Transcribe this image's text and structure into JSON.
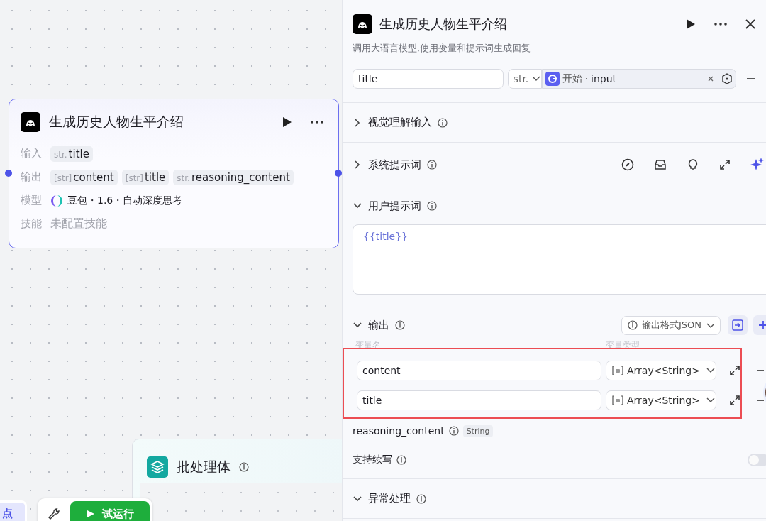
{
  "canvas": {
    "llm_node": {
      "title": "生成历史人物生平介绍",
      "selected": true,
      "rows": [
        {
          "kind": "tags",
          "label": "输入",
          "tags": [
            {
              "type": "str.",
              "name": "title"
            }
          ]
        },
        {
          "kind": "tags",
          "label": "输出",
          "tags": [
            {
              "type": "[str]",
              "name": "content"
            },
            {
              "type": "[str]",
              "name": "title"
            },
            {
              "type": "str.",
              "name": "reasoning_content"
            }
          ]
        },
        {
          "kind": "model",
          "label": "模型",
          "value": "豆包・1.6・自动深度思考"
        },
        {
          "kind": "empty",
          "label": "技能",
          "value": "未配置技能"
        }
      ]
    },
    "batch_node": {
      "title": "批处理体"
    },
    "toolbar": {
      "partial_button": "点",
      "run_button": "试运行"
    }
  },
  "panel": {
    "title": "生成历史人物生平介绍",
    "description": "调用大语言模型,使用变量和提示词生成回复",
    "input_row": {
      "name": "title",
      "type": "str.",
      "source_node": "开始",
      "separator": "·",
      "source_var": "input"
    },
    "sections": [
      {
        "kind": "plain",
        "title": "视觉理解输入",
        "expanded": false
      },
      {
        "kind": "system",
        "title": "系统提示词",
        "expanded": false
      },
      {
        "kind": "prompt",
        "title": "用户提示词",
        "expanded": true,
        "prompt": "{{title}}"
      },
      {
        "kind": "output",
        "title": "输出",
        "expanded": true,
        "format": "输出格式JSON",
        "columns": [
          "变量名",
          "变量类型"
        ],
        "rows": [
          {
            "name": "content",
            "type": "Array<String>"
          },
          {
            "name": "title",
            "type": "Array<String>"
          }
        ],
        "extra": {
          "name": "reasoning_content",
          "type": "String"
        },
        "continue": {
          "label": "支持续写",
          "on": false
        }
      },
      {
        "kind": "plain",
        "title": "异常处理",
        "expanded": true
      }
    ]
  }
}
